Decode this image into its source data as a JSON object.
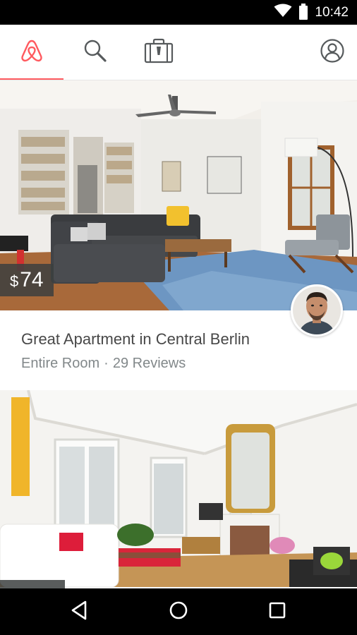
{
  "status_bar": {
    "time": "10:42",
    "icons": [
      "wifi-icon",
      "battery-icon"
    ]
  },
  "top_nav": {
    "tabs": [
      {
        "name": "home",
        "icon": "airbnb-logo-icon",
        "active": true
      },
      {
        "name": "search",
        "icon": "search-icon",
        "active": false
      },
      {
        "name": "trips",
        "icon": "suitcase-icon",
        "active": false
      },
      {
        "name": "profile",
        "icon": "profile-icon",
        "active": false
      }
    ],
    "accent": "#ff5a5f"
  },
  "listings": [
    {
      "price": {
        "currency": "$",
        "amount": "74"
      },
      "title": "Great Apartment in Central Berlin",
      "room_type": "Entire Room",
      "separator": "·",
      "reviews": "29 Reviews",
      "photo": "living-room-photo",
      "host": "host-avatar-photo"
    },
    {
      "photo": "parisian-living-room-photo"
    }
  ],
  "android_nav": {
    "buttons": [
      "back-icon",
      "home-icon",
      "recents-icon"
    ]
  },
  "colors": {
    "title": "#484848",
    "subtitle": "#82888a",
    "price_bg": "#3c3f40"
  }
}
